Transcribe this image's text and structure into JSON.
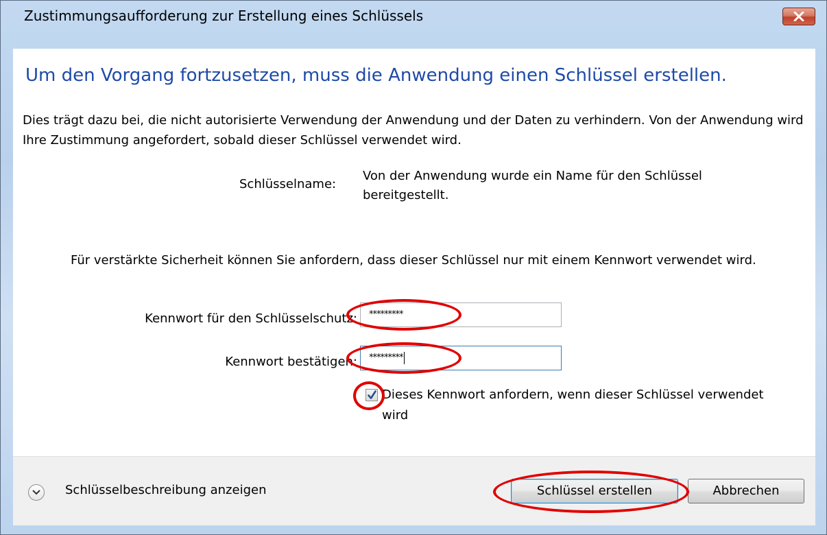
{
  "window": {
    "title": "Zustimmungsaufforderung zur Erstellung eines Schlüssels"
  },
  "heading": "Um den Vorgang fortzusetzen, muss die Anwendung einen Schlüssel erstellen.",
  "description": "Dies trägt dazu bei, die nicht autorisierte Verwendung der Anwendung und der Daten zu verhindern. Von der Anwendung wird Ihre Zustimmung angefordert, sobald dieser Schlüssel verwendet wird.",
  "key_name": {
    "label": "Schlüsselname:",
    "value": "Von der Anwendung wurde ein Name für den Schlüssel bereitgestellt."
  },
  "security_note": "Für verstärkte Sicherheit können Sie anfordern, dass dieser Schlüssel nur mit einem Kennwort verwendet wird.",
  "password": {
    "label": "Kennwort für den Schlüsselschutz:",
    "value": "*********"
  },
  "confirm_password": {
    "label": "Kennwort bestätigen:",
    "value": "*********"
  },
  "require_password_checkbox": {
    "label": "Dieses Kennwort anfordern, wenn dieser Schlüssel verwendet wird",
    "checked": true
  },
  "footer": {
    "expander_label": "Schlüsselbeschreibung anzeigen",
    "create_button": "Schlüssel erstellen",
    "cancel_button": "Abbrechen"
  },
  "colors": {
    "heading": "#1e4aa8",
    "annotation": "#e00000"
  }
}
